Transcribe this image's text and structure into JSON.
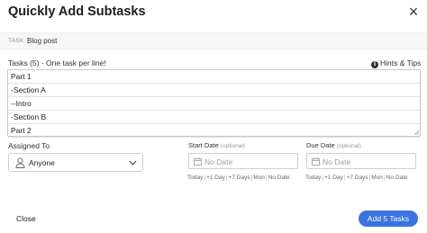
{
  "header": {
    "title": "Quickly Add Subtasks",
    "close_symbol": "×"
  },
  "task": {
    "tag": "TASK",
    "name": "Blog post"
  },
  "tasks": {
    "label": "Tasks (5) - One task per line!",
    "hints_label": "Hints & Tips",
    "hints_icon": "info-icon",
    "lines": [
      "Part 1",
      "-Section A",
      "--Intro",
      "-Section B",
      "Part 2"
    ]
  },
  "assigned": {
    "label": "Assigned To",
    "value": "Anyone",
    "icon": "person-icon"
  },
  "start_date": {
    "label": "Start Date",
    "optional": "(optional)",
    "placeholder": "No Date",
    "icon": "calendar-icon",
    "quick": [
      "Today",
      "+1 Day",
      "+7 Days",
      "Mon",
      "No Date"
    ]
  },
  "due_date": {
    "label": "Due Date",
    "optional": "(optional)",
    "placeholder": "No Date",
    "icon": "calendar-icon",
    "quick": [
      "Today",
      "+1 Day",
      "+7 Days",
      "Mon",
      "No Date"
    ]
  },
  "footer": {
    "close_label": "Close",
    "add_label": "Add 5 Tasks"
  },
  "colors": {
    "accent": "#3b73e0",
    "task_bar_bg": "#f7f7f7"
  }
}
